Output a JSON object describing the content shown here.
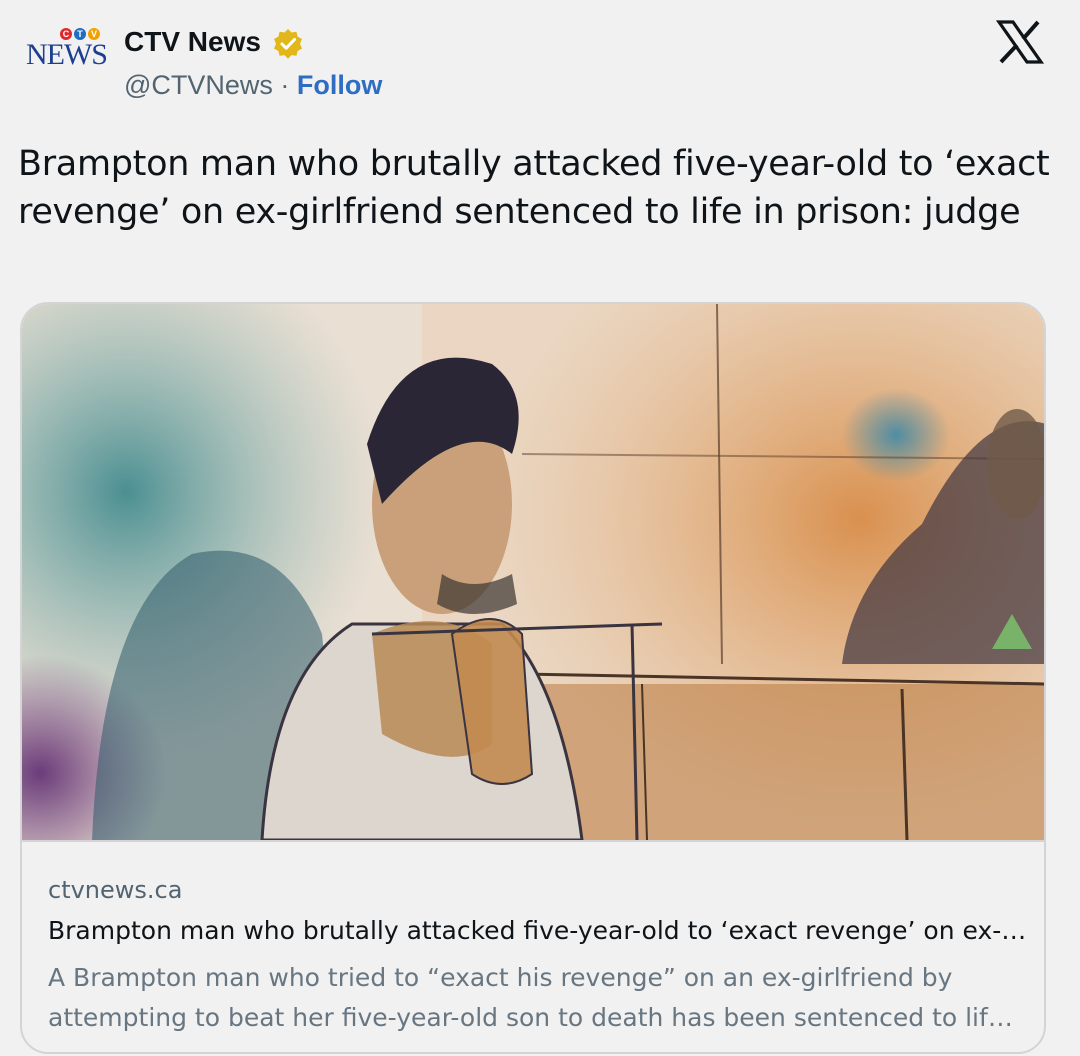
{
  "author": {
    "logo_top": "CTV",
    "logo_bottom": "NEWS",
    "name": "CTV News",
    "handle": "@CTVNews",
    "separator": " · ",
    "follow_label": "Follow"
  },
  "icons": {
    "verified": "verified-badge-icon",
    "platform": "x-logo-icon"
  },
  "tweet": {
    "text": "Brampton man who brutally attacked five-year-old to ‘exact revenge’ on ex-girlfriend sentenced to life in prison: judge"
  },
  "card": {
    "image_description": "courtroom-sketch",
    "domain": "ctvnews.ca",
    "title": "Brampton man who brutally attacked five-year-old to ‘exact revenge’ on ex-girlfriend sentenced to life in prison: judge",
    "description": "A Brampton man who tried to “exact his revenge” on an ex-girlfriend by attempting to beat her five-year-old son to death has been sentenced to life in prison."
  },
  "colors": {
    "background": "#f1f1f1",
    "follow": "#2f6dc2",
    "verified_gold": "#e2b719",
    "text_primary": "#0f1419",
    "text_secondary": "#536471"
  }
}
